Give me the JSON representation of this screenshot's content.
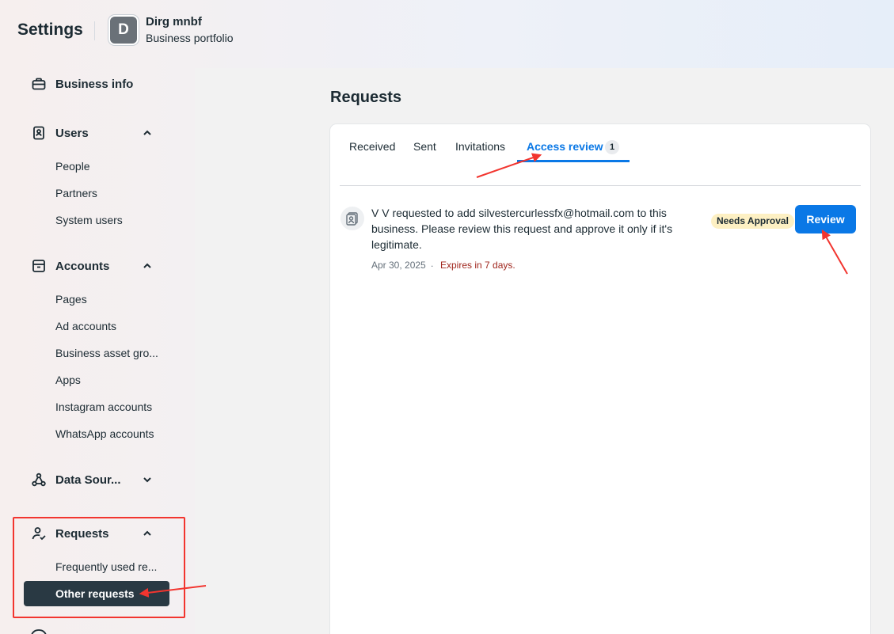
{
  "header": {
    "settings_title": "Settings",
    "business_initial": "D",
    "business_name": "Dirg mnbf",
    "business_subtitle": "Business portfolio"
  },
  "sidebar": {
    "business_info": "Business info",
    "users": {
      "label": "Users",
      "items": [
        "People",
        "Partners",
        "System users"
      ]
    },
    "accounts": {
      "label": "Accounts",
      "items": [
        "Pages",
        "Ad accounts",
        "Business asset gro...",
        "Apps",
        "Instagram accounts",
        "WhatsApp accounts"
      ]
    },
    "data_sources": "Data Sour...",
    "requests": {
      "label": "Requests",
      "items": [
        "Frequently used re...",
        "Other requests"
      ]
    }
  },
  "main": {
    "title": "Requests",
    "tabs": [
      "Received",
      "Sent",
      "Invitations",
      "Access review"
    ],
    "active_tab": "Access review",
    "access_review_count": "1",
    "request": {
      "message": "V V requested to add silvestercurlessfx@hotmail.com to this business. Please review this request and approve it only if it's legitimate.",
      "date": "Apr 30, 2025",
      "separator": ".",
      "expires": "Expires in 7 days.",
      "status_badge": "Needs Approval",
      "review_label": "Review"
    }
  },
  "colors": {
    "accent": "#0a78e6",
    "active_nav": "#293943",
    "annotation_red": "#f2352f",
    "badge_bg": "#fdf0c3",
    "expires_text": "#a0261d"
  }
}
